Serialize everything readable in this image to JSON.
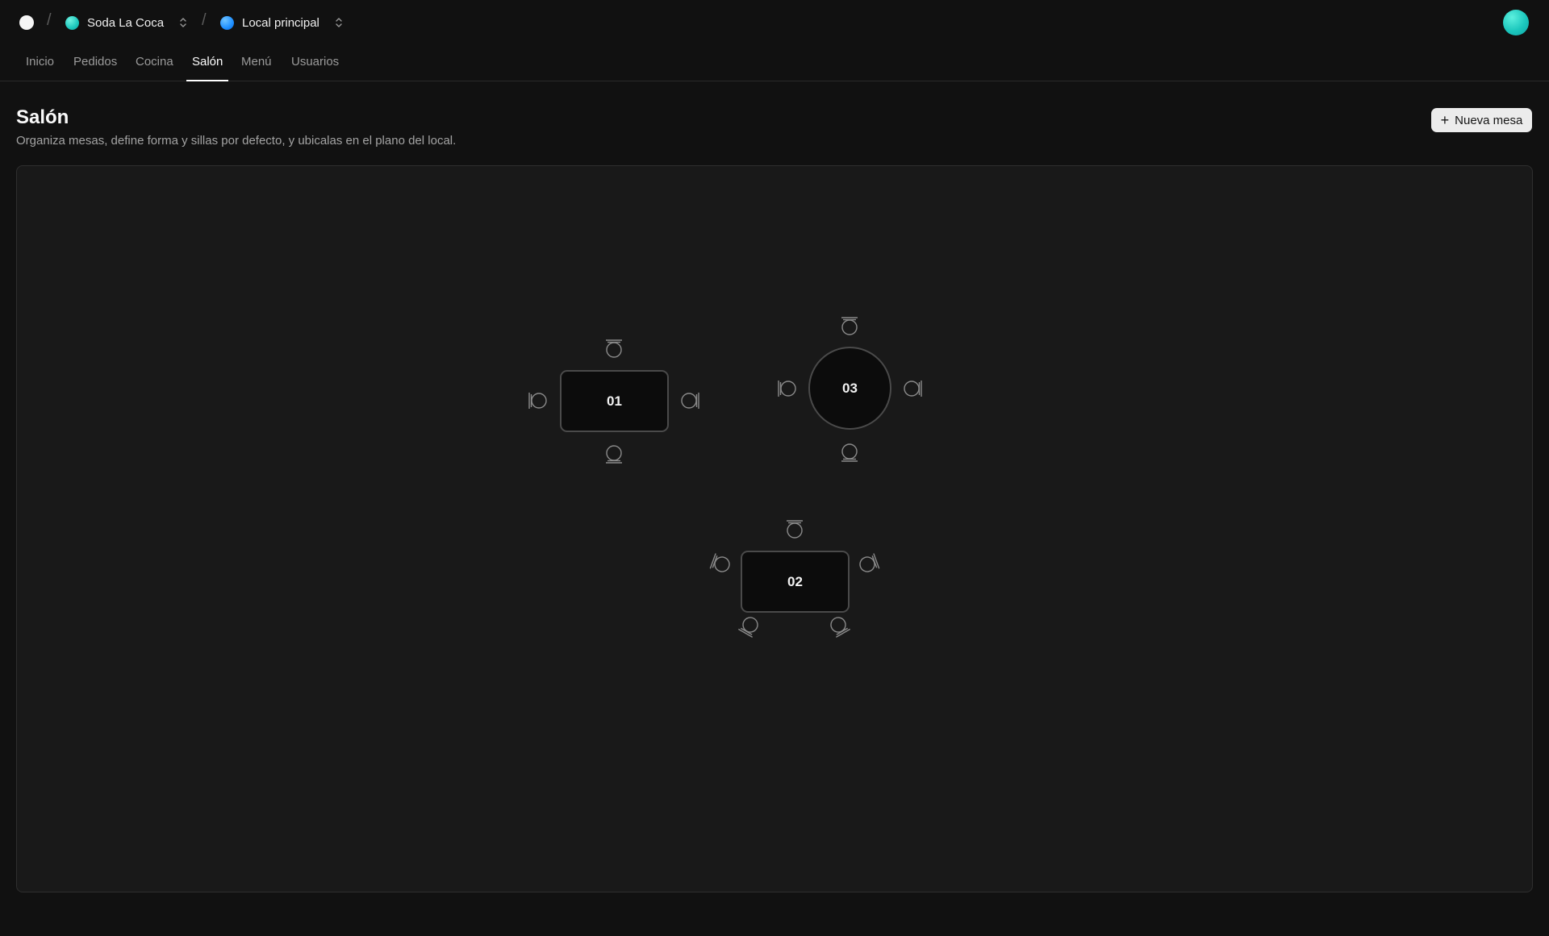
{
  "header": {
    "logo_icon": "app-logo-dot",
    "separator": "/",
    "business": {
      "name": "Soda La Coca",
      "color": "#1fc9bd",
      "icon": "chevron-up-down-icon"
    },
    "location": {
      "name": "Local principal",
      "color": "#1e8fff",
      "icon": "chevron-up-down-icon"
    },
    "user_avatar_color": "#2bd6c6"
  },
  "nav": {
    "tabs": [
      {
        "label": "Inicio",
        "active": false
      },
      {
        "label": "Pedidos",
        "active": false
      },
      {
        "label": "Cocina",
        "active": false
      },
      {
        "label": "Salón",
        "active": true
      },
      {
        "label": "Menú",
        "active": false
      },
      {
        "label": "Usuarios",
        "active": false
      }
    ]
  },
  "page": {
    "title": "Salón",
    "subtitle": "Organiza mesas, define forma y sillas por defecto, y ubicalas en el plano del local.",
    "new_table_label": "Nueva mesa",
    "new_table_icon": "plus-icon"
  },
  "floor_plan": {
    "tables": [
      {
        "label": "01",
        "shape": "rectangle",
        "chairs": 4
      },
      {
        "label": "03",
        "shape": "circle",
        "chairs": 4
      },
      {
        "label": "02",
        "shape": "rectangle",
        "chairs": 5
      }
    ]
  },
  "colors": {
    "background": "#111111",
    "canvas": "#191919",
    "table_fill": "#0c0c0c",
    "table_border": "#4a4a4a",
    "chair_stroke": "#8a8a8a",
    "accent_button": "#ececec"
  }
}
